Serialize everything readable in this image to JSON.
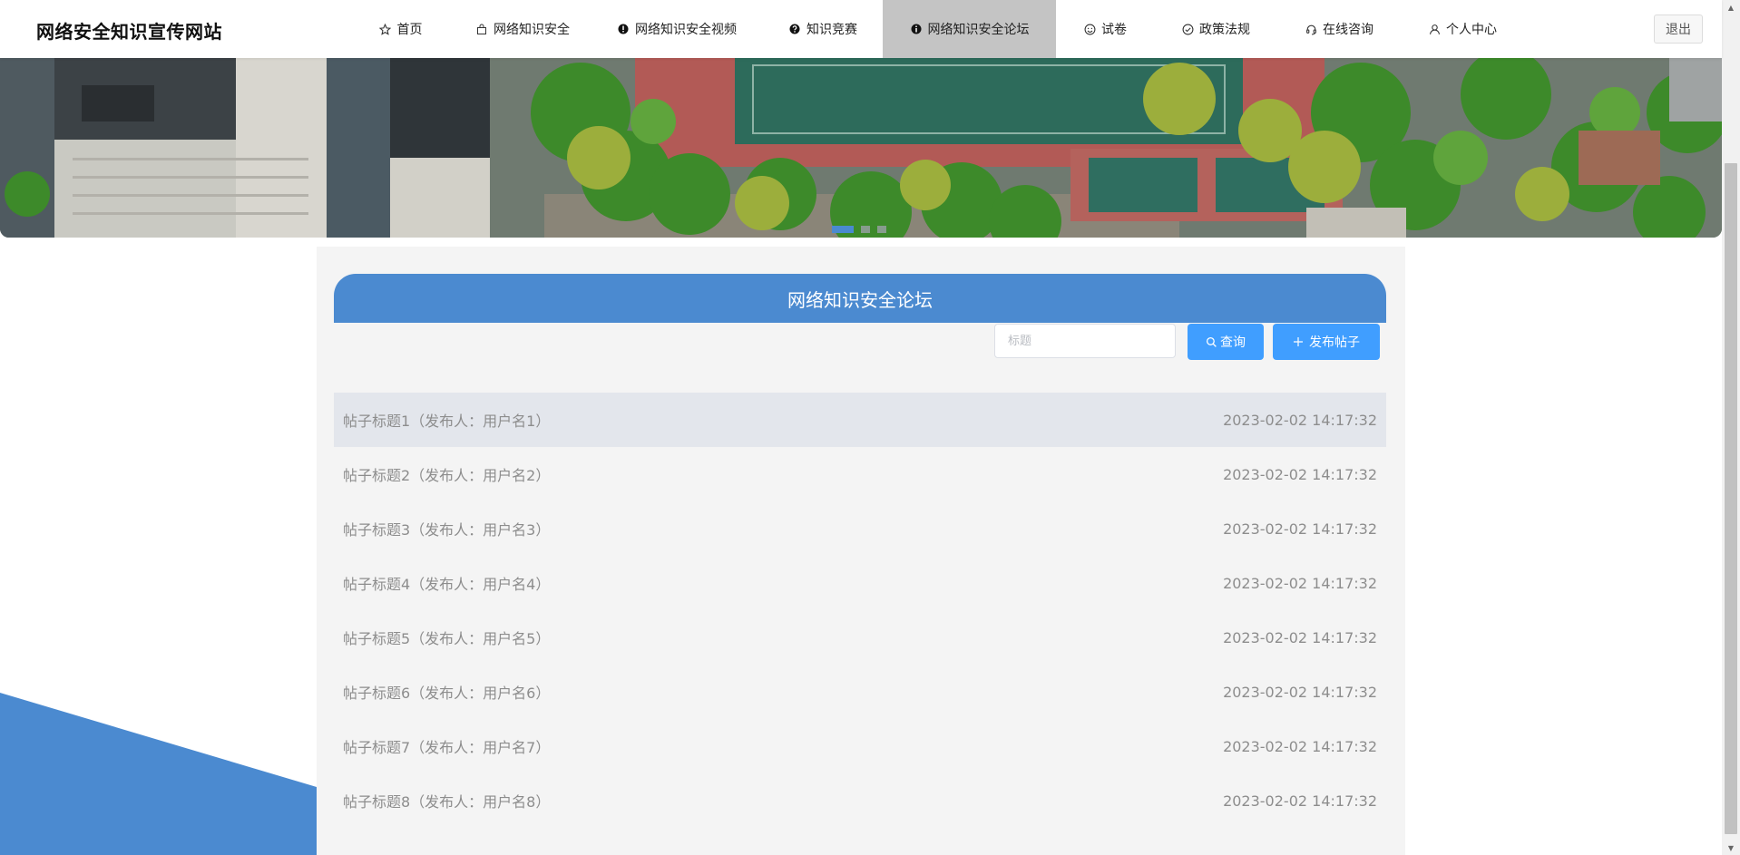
{
  "site": {
    "title": "网络安全知识宣传网站"
  },
  "nav": {
    "items": [
      {
        "label": "首页",
        "icon": "star-icon"
      },
      {
        "label": "网络知识安全",
        "icon": "bag-icon"
      },
      {
        "label": "网络知识安全视频",
        "icon": "exclamation-icon"
      },
      {
        "label": "知识竞赛",
        "icon": "question-icon"
      },
      {
        "label": "网络知识安全论坛",
        "icon": "info-icon",
        "active": true
      },
      {
        "label": "试卷",
        "icon": "smile-icon"
      },
      {
        "label": "政策法规",
        "icon": "check-circle-icon"
      },
      {
        "label": "在线咨询",
        "icon": "headset-icon"
      },
      {
        "label": "个人中心",
        "icon": "user-icon"
      }
    ],
    "logout_label": "退出"
  },
  "banner": {
    "active_slide": 1,
    "slide_count": 3
  },
  "forum": {
    "heading": "网络知识安全论坛",
    "search_placeholder": "标题",
    "search_button": "查询",
    "post_button": "发布帖子",
    "posts": [
      {
        "title": "帖子标题1（发布人：用户名1）",
        "time": "2023-02-02 14:17:32"
      },
      {
        "title": "帖子标题2（发布人：用户名2）",
        "time": "2023-02-02 14:17:32"
      },
      {
        "title": "帖子标题3（发布人：用户名3）",
        "time": "2023-02-02 14:17:32"
      },
      {
        "title": "帖子标题4（发布人：用户名4）",
        "time": "2023-02-02 14:17:32"
      },
      {
        "title": "帖子标题5（发布人：用户名5）",
        "time": "2023-02-02 14:17:32"
      },
      {
        "title": "帖子标题6（发布人：用户名6）",
        "time": "2023-02-02 14:17:32"
      },
      {
        "title": "帖子标题7（发布人：用户名7）",
        "time": "2023-02-02 14:17:32"
      },
      {
        "title": "帖子标题8（发布人：用户名8）",
        "time": "2023-02-02 14:17:32"
      }
    ]
  },
  "colors": {
    "primary": "#409eff",
    "header_blue": "#4b8ad0",
    "nav_active": "#c4c4c4"
  }
}
